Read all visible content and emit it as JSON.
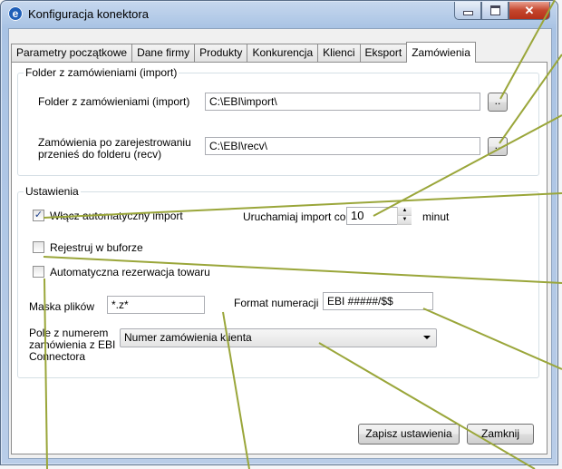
{
  "window": {
    "title": "Konfiguracja konektora",
    "app_icon": "e"
  },
  "tabs": [
    {
      "label": "Parametry początkowe",
      "active": false
    },
    {
      "label": "Dane firmy",
      "active": false
    },
    {
      "label": "Produkty",
      "active": false
    },
    {
      "label": "Konkurencja",
      "active": false
    },
    {
      "label": "Klienci",
      "active": false
    },
    {
      "label": "Eksport",
      "active": false
    },
    {
      "label": "Zamówienia",
      "active": true
    }
  ],
  "import_group": {
    "legend": "Folder z zamówieniami (import)",
    "import_label": "Folder z zamówieniami (import)",
    "import_value": "C:\\EBI\\import\\",
    "recv_label_line1": "Zamówienia po zarejestrowaniu",
    "recv_label_line2": "przenieś do folderu (recv)",
    "recv_value": "C:\\EBI\\recv\\",
    "browse_label": ".."
  },
  "settings_group": {
    "legend": "Ustawienia",
    "auto_import_label": "Włącz automatyczny import",
    "auto_import_checked": true,
    "interval_label": "Uruchamiaj import co",
    "interval_value": "10",
    "interval_unit": "minut",
    "buffer_label": "Rejestruj w buforze",
    "buffer_checked": false,
    "reservation_label": "Automatyczna rezerwacja towaru",
    "reservation_checked": false,
    "mask_label": "Maska plików",
    "mask_value": "*.z*",
    "numbering_label": "Format numeracji",
    "numbering_value": "EBI #####/$$",
    "field_label_line1": "Pole z numerem",
    "field_label_line2": "zamówienia z EBI",
    "field_label_line3": "Connectora",
    "field_select_value": "Numer zamówienia klienta"
  },
  "footer": {
    "save_label": "Zapisz ustawienia",
    "close_label": "Zamknij"
  },
  "colors": {
    "callout_line": "#9aa63a",
    "titlebar": "#b9cde8",
    "close_button": "#c4452c"
  }
}
